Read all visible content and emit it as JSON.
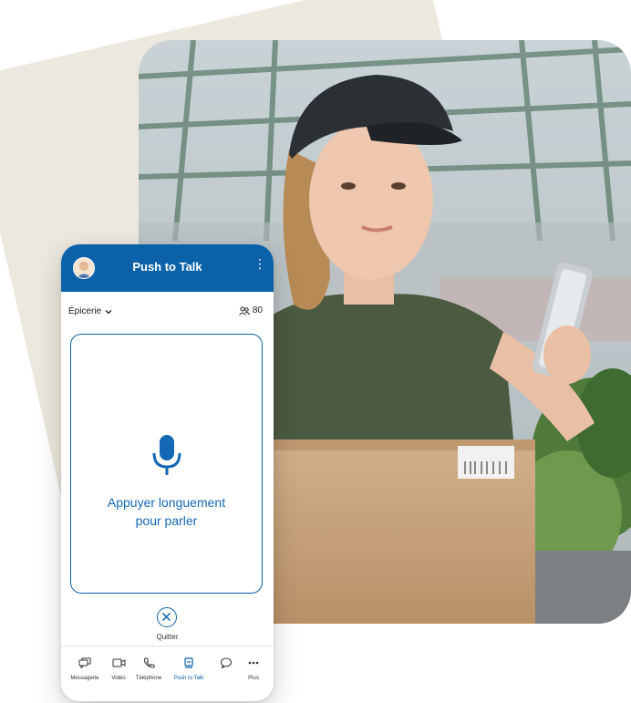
{
  "phone": {
    "header_title": "Push to Talk",
    "menu_icon": "⋮",
    "channel_name": "Épicerie",
    "member_count": "80",
    "ptt_line1": "Appuyer longuement",
    "ptt_line2": "pour parler",
    "quit_label": "Quitter",
    "nav": [
      {
        "label": "Messagerie",
        "icon": "chat-bubbles-icon"
      },
      {
        "label": "Vidéo",
        "icon": "video-camera-icon"
      },
      {
        "label": "Téléphone",
        "icon": "phone-icon"
      },
      {
        "label": "Push to Talk",
        "icon": "walkie-talkie-icon",
        "active": true
      },
      {
        "label": "",
        "icon": "speech-bubble-icon"
      },
      {
        "label": "Plus",
        "icon": "more-dots-icon"
      }
    ]
  },
  "colors": {
    "brand_blue": "#0b62a9",
    "card_beige": "#ece8df"
  }
}
